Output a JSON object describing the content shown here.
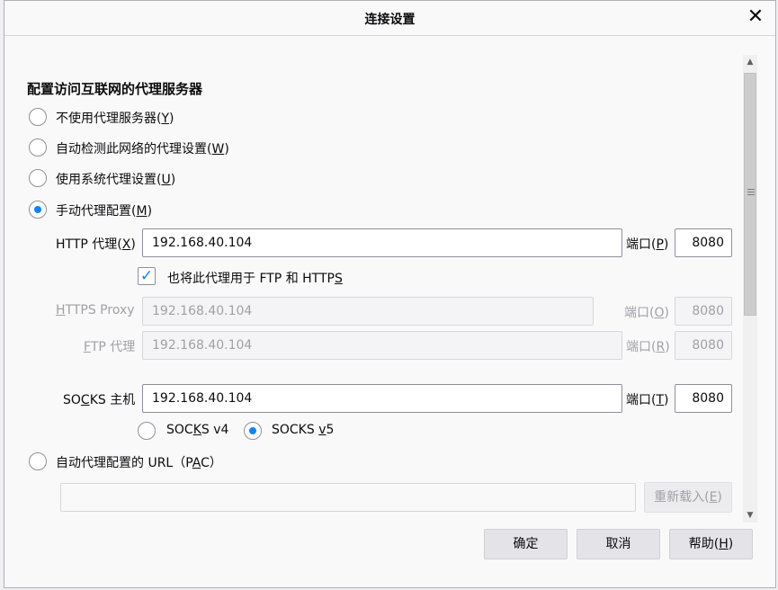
{
  "dialog": {
    "title": "连接设置",
    "close_glyph": "✕"
  },
  "section_heading": "配置访问互联网的代理服务器",
  "proxy_options": [
    {
      "pre": "不使用代理服务器(",
      "key": "Y",
      "post": ")",
      "selected": false
    },
    {
      "pre": "自动检测此网络的代理设置(",
      "key": "W",
      "post": ")",
      "selected": false
    },
    {
      "pre": "使用系统代理设置(",
      "key": "U",
      "post": ")",
      "selected": false
    },
    {
      "pre": "手动代理配置(",
      "key": "M",
      "post": ")",
      "selected": true
    }
  ],
  "http": {
    "label_pre": "HTTP 代理(",
    "label_key": "X",
    "label_post": ")",
    "value": "192.168.40.104",
    "port_label_pre": "端口(",
    "port_label_key": "P",
    "port_label_post": ")",
    "port": "8080"
  },
  "also_use": {
    "label_pre": "也将此代理用于 FTP 和 HTTP",
    "label_key": "S",
    "label_post": "",
    "checked": true,
    "check_glyph": "✓"
  },
  "https": {
    "label_pre": "",
    "label_key": "H",
    "label_post": "TTPS Proxy",
    "value": "192.168.40.104",
    "port_label_pre": "端口(",
    "port_label_key": "O",
    "port_label_post": ")",
    "port": "8080"
  },
  "ftp": {
    "label_pre": "",
    "label_key": "F",
    "label_post": "TP 代理",
    "value": "192.168.40.104",
    "port_label_pre": "端口(",
    "port_label_key": "R",
    "port_label_post": ")",
    "port": "8080"
  },
  "socks": {
    "label_pre": "SO",
    "label_key": "C",
    "label_post": "KS 主机",
    "value": "192.168.40.104",
    "port_label_pre": "端口(",
    "port_label_key": "T",
    "port_label_post": ")",
    "port": "8080",
    "v4": {
      "pre": "SOC",
      "key": "K",
      "post": "S v4",
      "selected": false
    },
    "v5": {
      "pre": "SOCKS ",
      "key": "v",
      "post": "5",
      "selected": true
    }
  },
  "pac": {
    "pre": "自动代理配置的 URL（P",
    "key": "A",
    "post": "C）",
    "selected": false,
    "value": "",
    "reload_pre": "重新载入(",
    "reload_key": "E",
    "reload_post": ")"
  },
  "buttons": {
    "ok": "确定",
    "cancel": "取消",
    "help_pre": "帮助(",
    "help_key": "H",
    "help_post": ")"
  },
  "scrollbar": {
    "up_glyph": "▲",
    "down_glyph": "▼"
  },
  "colors": {
    "accent": "#0a84ff",
    "disabled_text": "#a0a0a6"
  }
}
